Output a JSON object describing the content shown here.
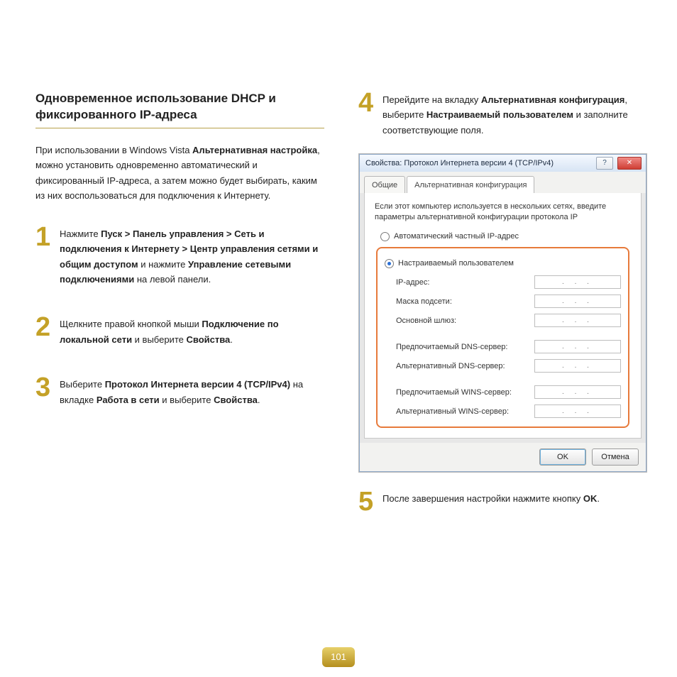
{
  "title": "Одновременное использование DHCP и фиксированного IP-адреса",
  "intro_pre": "При использовании в Windows Vista ",
  "intro_b": "Альтернативная настройка",
  "intro_post": ", можно установить одновременно автоматический и фиксированный IP-адреса, а затем можно будет выбирать, каким из них воспользоваться для подключения к Интернету.",
  "steps": {
    "s1n": "1",
    "s1a": "Нажмите ",
    "s1b": "Пуск > Панель управления > Сеть и подключения к Интернету > Центр управления сетями и общим доступом",
    "s1c": " и нажмите ",
    "s1d": "Управление сетевыми подключениями",
    "s1e": " на левой панели.",
    "s2n": "2",
    "s2a": "Щелкните правой кнопкой мыши ",
    "s2b": "Подключение по локальной сети",
    "s2c": " и выберите ",
    "s2d": "Свойства",
    "s2e": ".",
    "s3n": "3",
    "s3a": "Выберите ",
    "s3b": "Протокол Интернета версии 4 (TCP/IPv4)",
    "s3c": " на вкладке ",
    "s3d": "Работа в сети",
    "s3e": " и выберите ",
    "s3f": "Свойства",
    "s3g": ".",
    "s4n": "4",
    "s4a": "Перейдите на вкладку ",
    "s4b": "Альтернативная конфигурация",
    "s4c": ", выберите ",
    "s4d": "Настраиваемый пользователем",
    "s4e": " и заполните соответствующие поля.",
    "s5n": "5",
    "s5a": "После завершения настройки нажмите кнопку ",
    "s5b": "OK",
    "s5c": "."
  },
  "dlg": {
    "title": "Свойства: Протокол Интернета версии 4 (TCP/IPv4)",
    "help": "?",
    "close": "✕",
    "tab1": "Общие",
    "tab2": "Альтернативная конфигурация",
    "hint": "Если этот компьютер используется в нескольких сетях, введите параметры альтернативной конфигурации протокола IP",
    "r1": "Автоматический частный IP-адрес",
    "r2": "Настраиваемый пользователем",
    "f_ip": "IP-адрес:",
    "f_mask": "Маска подсети:",
    "f_gw": "Основной шлюз:",
    "f_dns1": "Предпочитаемый DNS-сервер:",
    "f_dns2": "Альтернативный DNS-сервер:",
    "f_wins1": "Предпочитаемый WINS-сервер:",
    "f_wins2": "Альтернативный WINS-сервер:",
    "ip_ph": ".  .  .",
    "ok": "OK",
    "cancel": "Отмена"
  },
  "page_number": "101"
}
